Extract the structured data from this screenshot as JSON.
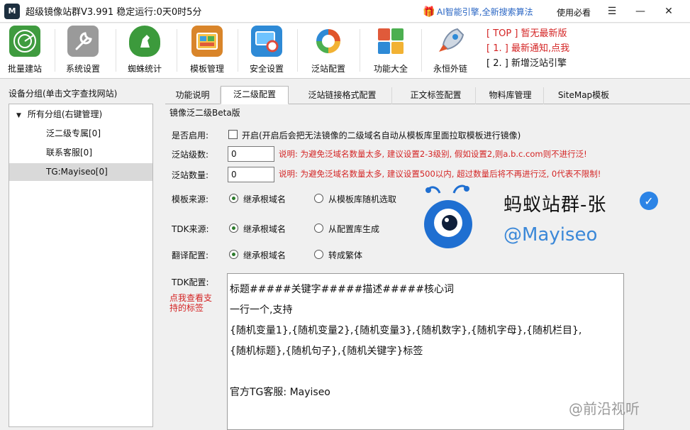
{
  "titlebar": {
    "app_title": "超级镜像站群V3.991 稳定运行:0天0时5分",
    "promo": "AI智能引擎,全新搜索算法",
    "help": "使用必看",
    "menu_icon": "hamburger-icon",
    "minimize": "—",
    "close": "✕"
  },
  "toolbar": {
    "items": [
      {
        "label": "批量建站",
        "icon": "radar-icon",
        "color": "#3f9b3f"
      },
      {
        "label": "系统设置",
        "icon": "wrench-icon",
        "color": "#7b7b7b"
      },
      {
        "label": "蜘蛛统计",
        "icon": "horse-shield-icon",
        "color": "#3c9a3c"
      },
      {
        "label": "模板管理",
        "icon": "template-box-icon",
        "color": "#d9852a"
      },
      {
        "label": "安全设置",
        "icon": "monitor-lifebuoy-icon",
        "color": "#2e8ad6"
      },
      {
        "label": "泛站配置",
        "icon": "cycle-icon",
        "color": "#e0552b"
      },
      {
        "label": "功能大全",
        "icon": "windows-tiles-icon",
        "color": "#e3a21f"
      },
      {
        "label": "永恒外链",
        "icon": "rocket-icon",
        "color": "#7d8fa8"
      }
    ],
    "notices": [
      {
        "text": "[ TOP ] 暂无最新版",
        "style": "red"
      },
      {
        "text": "[ 1. ] 最新通知,点我",
        "style": "red"
      },
      {
        "text": "[ 2. ] 新增泛站引擎",
        "style": "dark"
      }
    ]
  },
  "left_panel": {
    "header": "设备分组(单击文字查找网站)",
    "tree": [
      {
        "label": "所有分组(右键管理)",
        "expanded": true,
        "level": 0
      },
      {
        "label": "泛二级专属[0]",
        "level": 1
      },
      {
        "label": "联系客服[0]",
        "level": 1
      },
      {
        "label": "TG:Mayiseo[0]",
        "level": 1,
        "selected": true
      }
    ]
  },
  "tabs": [
    {
      "label": "功能说明"
    },
    {
      "label": "泛二级配置",
      "active": true
    },
    {
      "label": "泛站链接格式配置"
    },
    {
      "label": "正文标签配置"
    },
    {
      "label": "物料库管理"
    },
    {
      "label": "SiteMap模板"
    }
  ],
  "config": {
    "section_title": "镜像泛二级Beta版",
    "enable_label": "是否启用:",
    "enable_checkbox_text": "开启(开启后会把无法镜像的二级域名自动从模板库里面拉取模板进行镜像)",
    "enable_checked": false,
    "level_label": "泛站级数:",
    "level_value": "0",
    "level_note": "说明: 为避免泛域名数量太多, 建议设置2-3级别, 假如设置2,则a.b.c.com则不进行泛!",
    "count_label": "泛站数量:",
    "count_value": "0",
    "count_note": "说明: 为避免泛域名数量太多, 建议设置500以内, 超过数量后将不再进行泛, 0代表不限制!",
    "template_source_label": "模板来源:",
    "template_source_options": [
      "继承根域名",
      "从模板库随机选取"
    ],
    "template_source_selected": 0,
    "tdk_source_label": "TDK来源:",
    "tdk_source_options": [
      "继承根域名",
      "从配置库生成"
    ],
    "tdk_source_selected": 0,
    "translate_label": "翻译配置:",
    "translate_options": [
      "继承根域名",
      "转成繁体"
    ],
    "translate_selected": 0,
    "tdk_config_label": "TDK配置:",
    "tdk_help_link": "点我查看支持的标签",
    "tdk_text": "标题#####关键字#####描述#####核心词\n一行一个,支持\n{随机变量1},{随机变量2},{随机变量3},{随机数字},{随机字母},{随机栏目},\n{随机标题},{随机句子},{随机关键字}标签\n\n官方TG客服: Mayiseo"
  },
  "brand": {
    "name": "蚂蚁站群-张",
    "handle": "@Mayiseo",
    "verified_icon": "verified-check-icon"
  },
  "footer_watermark": "@前沿视听"
}
